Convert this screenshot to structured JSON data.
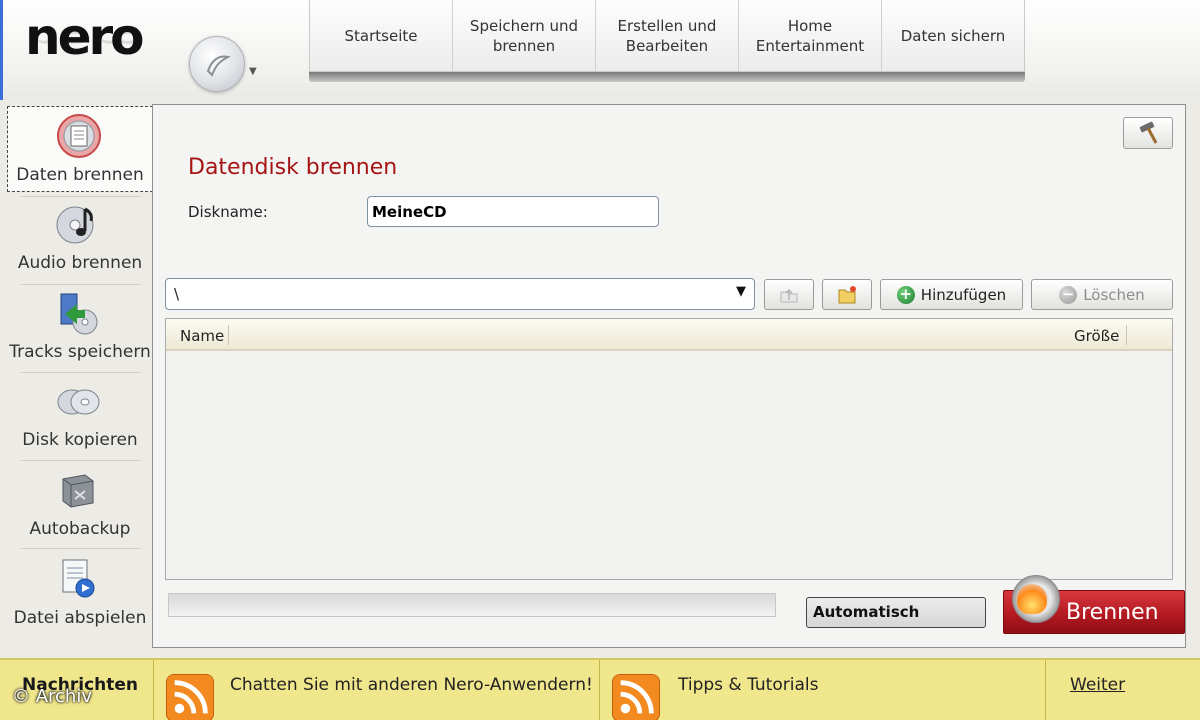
{
  "app": {
    "logo_text": "nero"
  },
  "nav": {
    "tabs": [
      {
        "label": "Startseite"
      },
      {
        "label": "Speichern und brennen"
      },
      {
        "label": "Erstellen und Bearbeiten"
      },
      {
        "label": "Home Entertainment"
      },
      {
        "label": "Daten sichern"
      }
    ]
  },
  "sidebar": {
    "items": [
      {
        "label": "Daten brennen",
        "icon": "data-disc-icon",
        "active": true
      },
      {
        "label": "Audio brennen",
        "icon": "music-disc-icon"
      },
      {
        "label": "Tracks speichern",
        "icon": "save-tracks-icon"
      },
      {
        "label": "Disk kopieren",
        "icon": "copy-disc-icon"
      },
      {
        "label": "Autobackup",
        "icon": "autobackup-icon"
      },
      {
        "label": "Datei abspielen",
        "icon": "play-file-icon"
      }
    ]
  },
  "main": {
    "title": "Datendisk brennen",
    "diskname_label": "Diskname:",
    "diskname_value": "MeineCD",
    "path_value": "\\",
    "add_label": "Hinzufügen",
    "delete_label": "Löschen",
    "table": {
      "columns": [
        "Name",
        "Größe"
      ],
      "rows": []
    },
    "progress": 0,
    "auto_label": "Automatisch",
    "burn_label": "Brennen"
  },
  "footer": {
    "news_title": "Nachrichten",
    "feed1": "Chatten Sie mit anderen Nero-Anwendern!",
    "feed2": "Tipps & Tutorials",
    "more_label": "Weiter",
    "copyright": "© Archiv"
  },
  "colors": {
    "accent_red": "#a61414",
    "burn_red": "#b51a22",
    "footer_yellow": "#f0e68c",
    "border_blue": "#3a6ed8"
  }
}
